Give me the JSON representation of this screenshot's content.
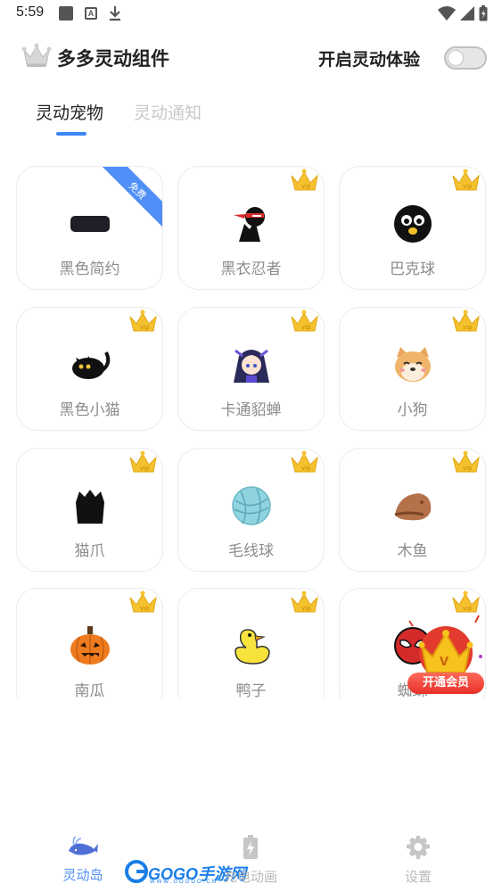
{
  "status_bar": {
    "time": "5:59"
  },
  "header": {
    "title": "多多灵动组件",
    "toggle_label": "开启灵动体验",
    "toggle_on": false
  },
  "tabs": [
    {
      "label": "灵动宠物",
      "active": true
    },
    {
      "label": "灵动通知",
      "active": false
    }
  ],
  "items": [
    {
      "label": "黑色简约",
      "icon": "black-pill-icon",
      "badge": "免费"
    },
    {
      "label": "黑衣忍者",
      "icon": "ninja-icon",
      "badge": "vip"
    },
    {
      "label": "巴克球",
      "icon": "black-ball-icon",
      "badge": "vip"
    },
    {
      "label": "黑色小猫",
      "icon": "black-cat-icon",
      "badge": "vip"
    },
    {
      "label": "卡通貂蝉",
      "icon": "cartoon-girl-icon",
      "badge": "vip"
    },
    {
      "label": "小狗",
      "icon": "shiba-dog-icon",
      "badge": "vip"
    },
    {
      "label": "猫爪",
      "icon": "cat-paw-icon",
      "badge": "vip"
    },
    {
      "label": "毛线球",
      "icon": "yarn-ball-icon",
      "badge": "vip"
    },
    {
      "label": "木鱼",
      "icon": "wooden-fish-icon",
      "badge": "vip"
    },
    {
      "label": "南瓜",
      "icon": "pumpkin-icon",
      "badge": "vip"
    },
    {
      "label": "鸭子",
      "icon": "duck-icon",
      "badge": "vip"
    },
    {
      "label": "蜘蛛",
      "icon": "spider-icon",
      "badge": "vip"
    }
  ],
  "vip_float": {
    "label": "开通会员"
  },
  "bottom_nav": [
    {
      "label": "灵动岛",
      "icon": "whale-icon",
      "active": true
    },
    {
      "label": "充电动画",
      "icon": "battery-icon",
      "active": false
    },
    {
      "label": "设置",
      "icon": "gear-icon",
      "active": false
    }
  ],
  "watermark": {
    "text": "GOGO手游网",
    "sub": "WWW.GOGOO.CN"
  },
  "colors": {
    "accent": "#3d86f5",
    "vip_gold": "#f5c22f",
    "label_gray": "#8c8c8c"
  }
}
